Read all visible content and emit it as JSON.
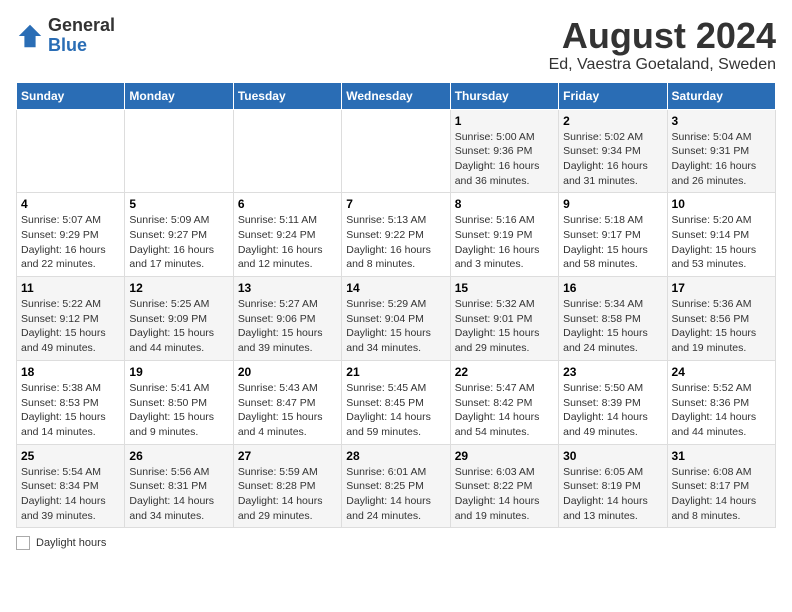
{
  "logo": {
    "general": "General",
    "blue": "Blue"
  },
  "title": "August 2024",
  "subtitle": "Ed, Vaestra Goetaland, Sweden",
  "days_of_week": [
    "Sunday",
    "Monday",
    "Tuesday",
    "Wednesday",
    "Thursday",
    "Friday",
    "Saturday"
  ],
  "footer_label": "Daylight hours",
  "weeks": [
    [
      {
        "day": "",
        "info": ""
      },
      {
        "day": "",
        "info": ""
      },
      {
        "day": "",
        "info": ""
      },
      {
        "day": "",
        "info": ""
      },
      {
        "day": "1",
        "info": "Sunrise: 5:00 AM\nSunset: 9:36 PM\nDaylight: 16 hours\nand 36 minutes."
      },
      {
        "day": "2",
        "info": "Sunrise: 5:02 AM\nSunset: 9:34 PM\nDaylight: 16 hours\nand 31 minutes."
      },
      {
        "day": "3",
        "info": "Sunrise: 5:04 AM\nSunset: 9:31 PM\nDaylight: 16 hours\nand 26 minutes."
      }
    ],
    [
      {
        "day": "4",
        "info": "Sunrise: 5:07 AM\nSunset: 9:29 PM\nDaylight: 16 hours\nand 22 minutes."
      },
      {
        "day": "5",
        "info": "Sunrise: 5:09 AM\nSunset: 9:27 PM\nDaylight: 16 hours\nand 17 minutes."
      },
      {
        "day": "6",
        "info": "Sunrise: 5:11 AM\nSunset: 9:24 PM\nDaylight: 16 hours\nand 12 minutes."
      },
      {
        "day": "7",
        "info": "Sunrise: 5:13 AM\nSunset: 9:22 PM\nDaylight: 16 hours\nand 8 minutes."
      },
      {
        "day": "8",
        "info": "Sunrise: 5:16 AM\nSunset: 9:19 PM\nDaylight: 16 hours\nand 3 minutes."
      },
      {
        "day": "9",
        "info": "Sunrise: 5:18 AM\nSunset: 9:17 PM\nDaylight: 15 hours\nand 58 minutes."
      },
      {
        "day": "10",
        "info": "Sunrise: 5:20 AM\nSunset: 9:14 PM\nDaylight: 15 hours\nand 53 minutes."
      }
    ],
    [
      {
        "day": "11",
        "info": "Sunrise: 5:22 AM\nSunset: 9:12 PM\nDaylight: 15 hours\nand 49 minutes."
      },
      {
        "day": "12",
        "info": "Sunrise: 5:25 AM\nSunset: 9:09 PM\nDaylight: 15 hours\nand 44 minutes."
      },
      {
        "day": "13",
        "info": "Sunrise: 5:27 AM\nSunset: 9:06 PM\nDaylight: 15 hours\nand 39 minutes."
      },
      {
        "day": "14",
        "info": "Sunrise: 5:29 AM\nSunset: 9:04 PM\nDaylight: 15 hours\nand 34 minutes."
      },
      {
        "day": "15",
        "info": "Sunrise: 5:32 AM\nSunset: 9:01 PM\nDaylight: 15 hours\nand 29 minutes."
      },
      {
        "day": "16",
        "info": "Sunrise: 5:34 AM\nSunset: 8:58 PM\nDaylight: 15 hours\nand 24 minutes."
      },
      {
        "day": "17",
        "info": "Sunrise: 5:36 AM\nSunset: 8:56 PM\nDaylight: 15 hours\nand 19 minutes."
      }
    ],
    [
      {
        "day": "18",
        "info": "Sunrise: 5:38 AM\nSunset: 8:53 PM\nDaylight: 15 hours\nand 14 minutes."
      },
      {
        "day": "19",
        "info": "Sunrise: 5:41 AM\nSunset: 8:50 PM\nDaylight: 15 hours\nand 9 minutes."
      },
      {
        "day": "20",
        "info": "Sunrise: 5:43 AM\nSunset: 8:47 PM\nDaylight: 15 hours\nand 4 minutes."
      },
      {
        "day": "21",
        "info": "Sunrise: 5:45 AM\nSunset: 8:45 PM\nDaylight: 14 hours\nand 59 minutes."
      },
      {
        "day": "22",
        "info": "Sunrise: 5:47 AM\nSunset: 8:42 PM\nDaylight: 14 hours\nand 54 minutes."
      },
      {
        "day": "23",
        "info": "Sunrise: 5:50 AM\nSunset: 8:39 PM\nDaylight: 14 hours\nand 49 minutes."
      },
      {
        "day": "24",
        "info": "Sunrise: 5:52 AM\nSunset: 8:36 PM\nDaylight: 14 hours\nand 44 minutes."
      }
    ],
    [
      {
        "day": "25",
        "info": "Sunrise: 5:54 AM\nSunset: 8:34 PM\nDaylight: 14 hours\nand 39 minutes."
      },
      {
        "day": "26",
        "info": "Sunrise: 5:56 AM\nSunset: 8:31 PM\nDaylight: 14 hours\nand 34 minutes."
      },
      {
        "day": "27",
        "info": "Sunrise: 5:59 AM\nSunset: 8:28 PM\nDaylight: 14 hours\nand 29 minutes."
      },
      {
        "day": "28",
        "info": "Sunrise: 6:01 AM\nSunset: 8:25 PM\nDaylight: 14 hours\nand 24 minutes."
      },
      {
        "day": "29",
        "info": "Sunrise: 6:03 AM\nSunset: 8:22 PM\nDaylight: 14 hours\nand 19 minutes."
      },
      {
        "day": "30",
        "info": "Sunrise: 6:05 AM\nSunset: 8:19 PM\nDaylight: 14 hours\nand 13 minutes."
      },
      {
        "day": "31",
        "info": "Sunrise: 6:08 AM\nSunset: 8:17 PM\nDaylight: 14 hours\nand 8 minutes."
      }
    ]
  ]
}
